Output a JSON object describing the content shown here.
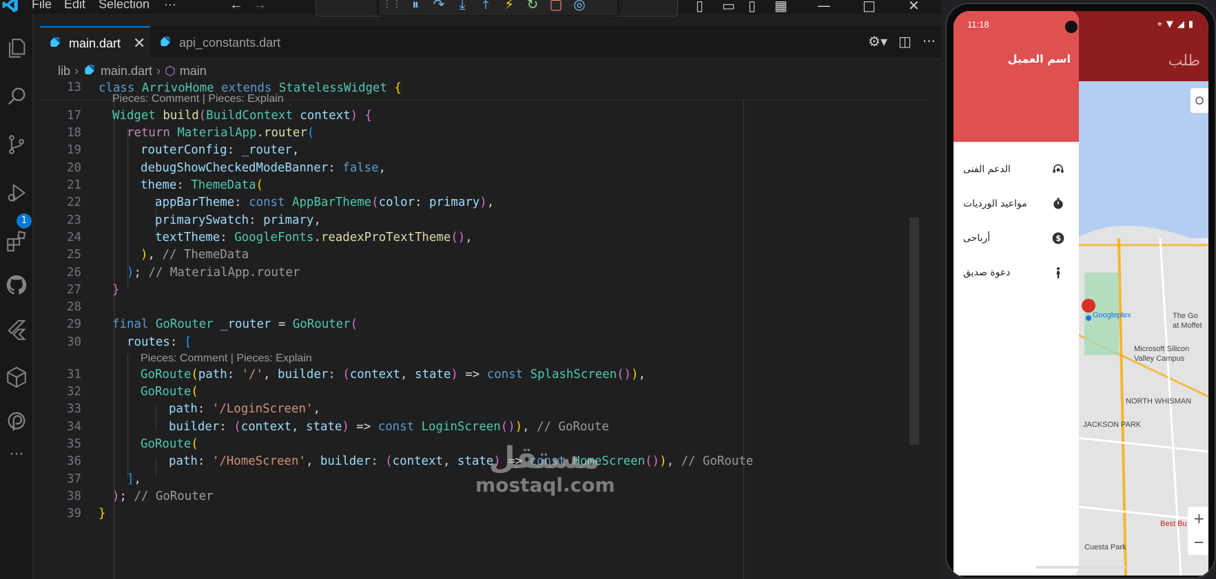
{
  "titlebar": {
    "menus": [
      "File",
      "Edit",
      "Selection",
      "···"
    ]
  },
  "tabs": [
    {
      "label": "main.dart",
      "active": true
    },
    {
      "label": "api_constants.dart",
      "active": false
    }
  ],
  "breadcrumb": [
    "lib",
    "main.dart",
    "main"
  ],
  "activity_badge": "1",
  "codelens": {
    "first": "Pieces: Comment | Pieces: Explain",
    "second": "Pieces: Comment | Pieces: Explain"
  },
  "line_numbers": [
    "13",
    "17",
    "18",
    "19",
    "20",
    "21",
    "22",
    "23",
    "24",
    "25",
    "26",
    "27",
    "28",
    "29",
    "30",
    "31",
    "32",
    "33",
    "34",
    "35",
    "36",
    "37",
    "38",
    "39"
  ],
  "watermark": {
    "arabic": "مستقل",
    "latin": "mostaql.com"
  },
  "phone": {
    "time": "11:18",
    "appbar_title": "طلب",
    "client_name": "اسم العميل",
    "drawer_items": [
      {
        "label": "الدعم الفنى",
        "icon": "support-agent-icon"
      },
      {
        "label": "مواعيد الورديات",
        "icon": "timer-icon"
      },
      {
        "label": "أرباحى",
        "icon": "dollar-circle-icon"
      },
      {
        "label": "دعوة صديق",
        "icon": "person-icon"
      }
    ],
    "map_labels": [
      "Googleplex",
      "Microsoft Silicon Valley Campus",
      "NORTH WHISMAN",
      "JACKSON PARK",
      "The Go at Moffet",
      "Cuesta Park",
      "Best Bu"
    ]
  },
  "colors": {
    "drawer_header": "#df5050",
    "appbar": "#8e1d1d",
    "accent": "#0078d4"
  }
}
